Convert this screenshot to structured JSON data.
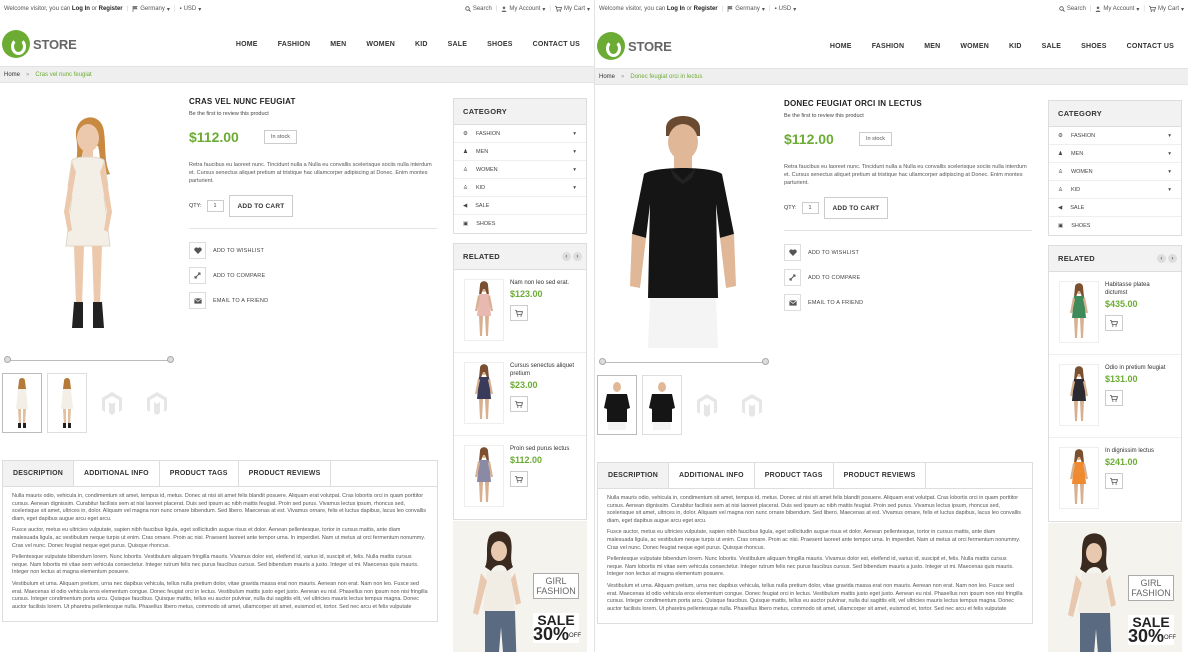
{
  "shots": [
    {
      "topbar": {
        "welcome": "Welcome visitor, you can",
        "login": "Log In",
        "or": "or",
        "register": "Register",
        "country": "Germany",
        "currency": "USD",
        "search": "Search",
        "account": "My Account",
        "cart": "My Cart"
      },
      "logo": "STORE",
      "nav": [
        "HOME",
        "FASHION",
        "MEN",
        "WOMEN",
        "KID",
        "SALE",
        "SHOES",
        "CONTACT US"
      ],
      "breadcrumb": {
        "home": "Home",
        "current": "Cras vel nunc feugiat"
      },
      "product": {
        "name": "CRAS VEL NUNC FEUGIAT",
        "review": "Be the first to review this product",
        "price": "$112.00",
        "stock": "In stock",
        "short_desc": "Retra faucibus eu laoreet nunc. Tincidunt nulla a Nulla eu convallis scelerisque sociis nulla interdum et. Cursus senectus aliquet pretium at tristique hac ullamcorper adipiscing at Donec. Enim montes parturient.",
        "qty_label": "QTY:",
        "qty": "1",
        "add_to_cart": "ADD TO CART",
        "wishlist": "ADD TO WISHLIST",
        "compare": "ADD TO COMPARE",
        "email": "EMAIL TO A FRIEND"
      },
      "tabs": [
        "DESCRIPTION",
        "ADDITIONAL INFO",
        "PRODUCT TAGS",
        "PRODUCT REVIEWS"
      ],
      "description": [
        "Nulla mauris odio, vehicula in, condimentum sit amet, tempus id, metus. Donec at nisi sit amet felis blandit posuere. Aliquam erat volutpat. Cras lobortis orci in quam porttitor cursus. Aenean dignissim. Curabitur facilisis sem at nisi laoreet placerat. Duis sed ipsum ac nibh mattis feugiat. Proin sed purus. Vivamus lectus ipsum, rhoncus sed, scelerisque sit amet, ultrices in, dolor. Aliquam vel magna non nunc ornare bibendum. Sed libero. Maecenas at est. Vivamus ornare, felis et luctus dapibus, lacus leo convallis diam, eget dapibus augue arcu eget arcu.",
        "Fusce auctor, metus eu ultricies vulputate, sapien nibh faucibus ligula, eget sollicitudin augue risus et dolor. Aenean pellentesque, tortor in cursus mattis, ante diam malesuada ligula, ac vestibulum neque turpis ut enim. Cras ornare. Proin ac nisi. Praesent laoreet ante tempor urna. In imperdiet. Nam ut metus at orci fermentum nonummy. Cras vel nunc. Donec feugiat neque eget purus. Quisque rhoncus.",
        "Pellentesque vulputate bibendum lorem. Nunc lobortis. Vestibulum aliquam fringilla mauris. Vivamus dolor est, eleifend id, varius id, suscipit et, felis. Nulla mattis cursus neque. Nam lobortis mi vitae sem vehicula consectetur. Integer rutrum felis nec purus faucibus cursus. Sed bibendum mauris a justo. Integer ut mi. Maecenas quis mauris. Integer non lectus at magna elementum posuere.",
        "Vestibulum et urna. Aliquam pretium, urna nec dapibus vehicula, tellus nulla pretium dolor, vitae gravida massa erat non mauris. Aenean non erat. Nam non leo. Fusce sed erat. Maecenas id odio vehicula eros elementum congue. Donec feugiat orci in lectus. Vestibulum mattis justo eget justo. Aenean eu nisl. Phasellus non ipsum non nisi fringilla cursus. Integer condimentum porta arcu. Quisque faucibus. Quisque mattis, tellus eu auctor pulvinar, nulla dui sagittis elit, vel ultricies mauris lectus tempus magna. Donec auctor facilisis lorem. Ut pharetra pellentesque nulla. Phasellus libero metus, commodo sit amet, ullamcorper sit amet, euismod et, tortor. Sed nec arcu et felis vulputate"
      ],
      "category": {
        "title": "CATEGORY",
        "items": [
          "FASHION",
          "MEN",
          "WOMEN",
          "KID",
          "SALE",
          "SHOES"
        ]
      },
      "related": {
        "title": "RELATED",
        "items": [
          {
            "name": "Nam non leo sed erat.",
            "price": "$123.00",
            "color": "#e8b9b0"
          },
          {
            "name": "Cursus senectus aliquet pretium",
            "price": "$23.00",
            "color": "#3a3a5a"
          },
          {
            "name": "Proin sed purus lectus",
            "price": "$112.00",
            "color": "#8a8aa5"
          }
        ]
      },
      "promo": {
        "line1": "GIRL",
        "line2": "FASHION",
        "sale": "SALE",
        "pct": "30%",
        "off": "OFF"
      }
    },
    {
      "topbar": {
        "welcome": "Welcome visitor, you can",
        "login": "Log In",
        "or": "or",
        "register": "Register",
        "country": "Germany",
        "currency": "USD",
        "search": "Search",
        "account": "My Account",
        "cart": "My Cart"
      },
      "logo": "STORE",
      "nav": [
        "HOME",
        "FASHION",
        "MEN",
        "WOMEN",
        "KID",
        "SALE",
        "SHOES",
        "CONTACT US"
      ],
      "breadcrumb": {
        "home": "Home",
        "current": "Donec feugiat orci in lectus"
      },
      "product": {
        "name": "DONEC FEUGIAT ORCI IN LECTUS",
        "review": "Be the first to review this product",
        "price": "$112.00",
        "stock": "In stock",
        "short_desc": "Retra faucibus eu laoreet nunc. Tincidunt nulla a Nulla eu convallis scelerisque sociis nulla interdum et. Cursus senectus aliquet pretium at tristique hac ullamcorper adipiscing at Donec. Enim montes parturient.",
        "qty_label": "QTY:",
        "qty": "1",
        "add_to_cart": "ADD TO CART",
        "wishlist": "ADD TO WISHLIST",
        "compare": "ADD TO COMPARE",
        "email": "EMAIL TO A FRIEND"
      },
      "tabs": [
        "DESCRIPTION",
        "ADDITIONAL INFO",
        "PRODUCT TAGS",
        "PRODUCT REVIEWS"
      ],
      "description": [
        "Nulla mauris odio, vehicula in, condimentum sit amet, tempus id, metus. Donec at nisi sit amet felis blandit posuere. Aliquam erat volutpat. Cras lobortis orci in quam porttitor cursus. Aenean dignissim. Curabitur facilisis sem at nisi laoreet placerat. Duis sed ipsum ac nibh mattis feugiat. Proin sed purus. Vivamus lectus ipsum, rhoncus sed, scelerisque sit amet, ultrices in, dolor. Aliquam vel magna non nunc ornare bibendum. Sed libero. Maecenas at est. Vivamus ornare, felis et luctus dapibus, lacus leo convallis diam, eget dapibus augue arcu eget arcu.",
        "Fusce auctor, metus eu ultricies vulputate, sapien nibh faucibus ligula, eget sollicitudin augue risus et dolor. Aenean pellentesque, tortor in cursus mattis, ante diam malesuada ligula, ac vestibulum neque turpis ut enim. Cras ornare. Proin ac nisi. Praesent laoreet ante tempor urna. In imperdiet. Nam ut metus at orci fermentum nonummy. Cras vel nunc. Donec feugiat neque eget purus. Quisque rhoncus.",
        "Pellentesque vulputate bibendum lorem. Nunc lobortis. Vestibulum aliquam fringilla mauris. Vivamus dolor est, eleifend id, varius id, suscipit et, felis. Nulla mattis cursus neque. Nam lobortis mi vitae sem vehicula consectetur. Integer rutrum felis nec purus faucibus cursus. Sed bibendum mauris a justo. Integer ut mi. Maecenas quis mauris. Integer non lectus at magna elementum posuere.",
        "Vestibulum et urna. Aliquam pretium, urna nec dapibus vehicula, tellus nulla pretium dolor, vitae gravida massa erat non mauris. Aenean non erat. Nam non leo. Fusce sed erat. Maecenas id odio vehicula eros elementum congue. Donec feugiat orci in lectus. Vestibulum mattis justo eget justo. Aenean eu nisl. Phasellus non ipsum non nisi fringilla cursus. Integer condimentum porta arcu. Quisque faucibus. Quisque mattis, tellus eu auctor pulvinar, nulla dui sagittis elit, vel ultricies mauris lectus tempus magna. Donec auctor facilisis lorem. Ut pharetra pellentesque nulla. Phasellus libero metus, commodo sit amet, ullamcorper sit amet, euismod et, tortor. Sed nec arcu et felis vulputate"
      ],
      "category": {
        "title": "CATEGORY",
        "items": [
          "FASHION",
          "MEN",
          "WOMEN",
          "KID",
          "SALE",
          "SHOES"
        ]
      },
      "related": {
        "title": "RELATED",
        "items": [
          {
            "name": "Habitasse platea dictumst",
            "price": "$435.00",
            "color": "#3f8a5a"
          },
          {
            "name": "Odio in pretium feugiat",
            "price": "$131.00",
            "color": "#2a2a30"
          },
          {
            "name": "In dignissim lectus",
            "price": "$241.00",
            "color": "#f08a30"
          }
        ]
      },
      "promo": {
        "line1": "GIRL",
        "line2": "FASHION",
        "sale": "SALE",
        "pct": "30%",
        "off": "OFF"
      }
    }
  ]
}
